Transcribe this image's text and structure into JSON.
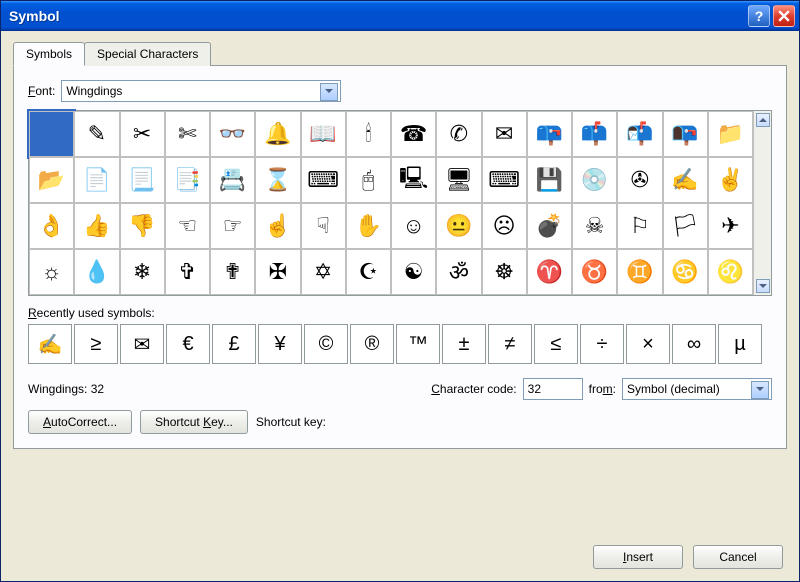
{
  "title": "Symbol",
  "tabs": [
    "Symbols",
    "Special Characters"
  ],
  "font_label": "Font:",
  "font_value": "Wingdings",
  "symbols_grid": [
    [
      " ",
      "✎",
      "✂",
      "✄",
      "👓",
      "🔔",
      "📖",
      "🕯",
      "☎",
      "✆",
      "✉",
      "📪",
      "📫",
      "📬",
      "📭",
      "📁"
    ],
    [
      "📂",
      "📄",
      "📃",
      "📑",
      "📇",
      "⌛",
      "⌨",
      "🖰",
      "🖳",
      "🖥",
      "⌨",
      "💾",
      "💿",
      "✇",
      "✍",
      "✌"
    ],
    [
      "👌",
      "👍",
      "👎",
      "☜",
      "☞",
      "☝",
      "☟",
      "✋",
      "☺",
      "😐",
      "☹",
      "💣",
      "☠",
      "⚐",
      "🏳",
      "✈"
    ],
    [
      "☼",
      "💧",
      "❄",
      "✞",
      "✟",
      "✠",
      "✡",
      "☪",
      "☯",
      "ॐ",
      "☸",
      "♈",
      "♉",
      "♊",
      "♋",
      "♌"
    ]
  ],
  "selected_index": 0,
  "recent_label": "Recently used symbols:",
  "recent_symbols": [
    "✍",
    "≥",
    "✉",
    "€",
    "£",
    "¥",
    "©",
    "®",
    "™",
    "±",
    "≠",
    "≤",
    "÷",
    "×",
    "∞",
    "µ"
  ],
  "status_font": "Wingdings: 32",
  "char_code_label": "Character code:",
  "char_code_value": "32",
  "from_label": "from:",
  "from_value": "Symbol (decimal)",
  "autocorrect_label": "AutoCorrect...",
  "shortcut_key_btn": "Shortcut Key...",
  "shortcut_key_label": "Shortcut key:",
  "insert_label": "Insert",
  "cancel_label": "Cancel"
}
